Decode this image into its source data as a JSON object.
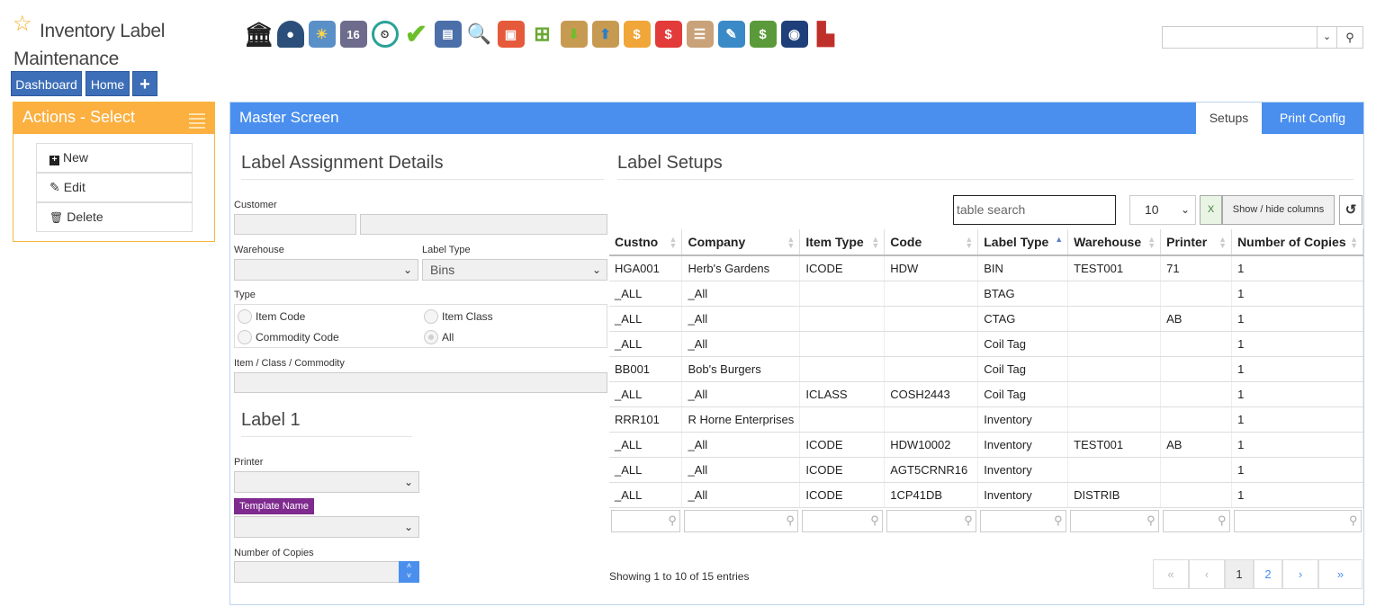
{
  "app": {
    "title": "Inventory Label Maintenance",
    "star_color": "#f2b01e"
  },
  "nav": {
    "dashboard": "Dashboard",
    "home": "Home",
    "add": "+"
  },
  "toolbar_icons": [
    "bank-icon",
    "user-icon",
    "weather-icon",
    "calendar-icon",
    "clock-icon",
    "checkmark-icon",
    "keyboard-icon",
    "magnifier-icon",
    "bus-icon",
    "basket-icon",
    "box-down-icon",
    "box-up-icon",
    "hand-money-icon",
    "chat-dollar-icon",
    "clipboard-icon",
    "pencil-icon",
    "money-icon",
    "phonebook-icon",
    "factory-icon"
  ],
  "calendar_day": "16",
  "actions": {
    "header": "Actions - Select",
    "items": [
      {
        "label": "New",
        "icon": "plus-square-icon"
      },
      {
        "label": "Edit",
        "icon": "pencil-icon"
      },
      {
        "label": "Delete",
        "icon": "trash-icon"
      }
    ]
  },
  "master": {
    "title": "Master Screen",
    "tabs": [
      "Setups",
      "Print Config"
    ]
  },
  "assignment": {
    "heading": "Label Assignment Details",
    "customer_label": "Customer",
    "warehouse_label": "Warehouse",
    "label_type_label": "Label Type",
    "label_type_value": "Bins",
    "type_label": "Type",
    "type_options": [
      "Item Code",
      "Item Class",
      "Commodity Code",
      "All"
    ],
    "type_selected": "All",
    "item_label": "Item / Class / Commodity"
  },
  "label1": {
    "heading": "Label 1",
    "printer_label": "Printer",
    "template_label": "Template Name",
    "copies_label": "Number of Copies"
  },
  "setups": {
    "heading": "Label Setups",
    "search_placeholder": "table search",
    "page_length": "10",
    "show_hide": "Show / hide columns",
    "columns": [
      "Custno",
      "Company",
      "Item Type",
      "Code",
      "Label Type",
      "Warehouse",
      "Printer",
      "Number of Copies"
    ],
    "rows": [
      [
        "HGA001",
        "Herb's Gardens",
        "ICODE",
        "HDW",
        "BIN",
        "TEST001",
        "71",
        "1"
      ],
      [
        "_ALL",
        "_All",
        "",
        "",
        "BTAG",
        "",
        "",
        "1"
      ],
      [
        "_ALL",
        "_All",
        "",
        "",
        "CTAG",
        "",
        "AB",
        "1"
      ],
      [
        "_ALL",
        "_All",
        "",
        "",
        "Coil Tag",
        "",
        "",
        "1"
      ],
      [
        "BB001",
        "Bob's Burgers",
        "",
        "",
        "Coil Tag",
        "",
        "",
        "1"
      ],
      [
        "_ALL",
        "_All",
        "ICLASS",
        "COSH2443",
        "Coil Tag",
        "",
        "",
        "1"
      ],
      [
        "RRR101",
        "R Horne Enterprises",
        "",
        "",
        "Inventory",
        "",
        "",
        "1"
      ],
      [
        "_ALL",
        "_All",
        "ICODE",
        "HDW10002",
        "Inventory",
        "TEST001",
        "AB",
        "1"
      ],
      [
        "_ALL",
        "_All",
        "ICODE",
        "AGT5CRNR16",
        "Inventory",
        "",
        "",
        "1"
      ],
      [
        "_ALL",
        "_All",
        "ICODE",
        "1CP41DB",
        "Inventory",
        "DISTRIB",
        "",
        "1"
      ]
    ],
    "info": "Showing 1 to 10 of 15 entries",
    "pager": [
      "«",
      "‹",
      "1",
      "2",
      "›",
      "»"
    ]
  },
  "colors": {
    "primary": "#4a8fee",
    "actions": "#fbb040",
    "nav": "#3d6fb8",
    "template_badge": "#7e2a8e"
  }
}
